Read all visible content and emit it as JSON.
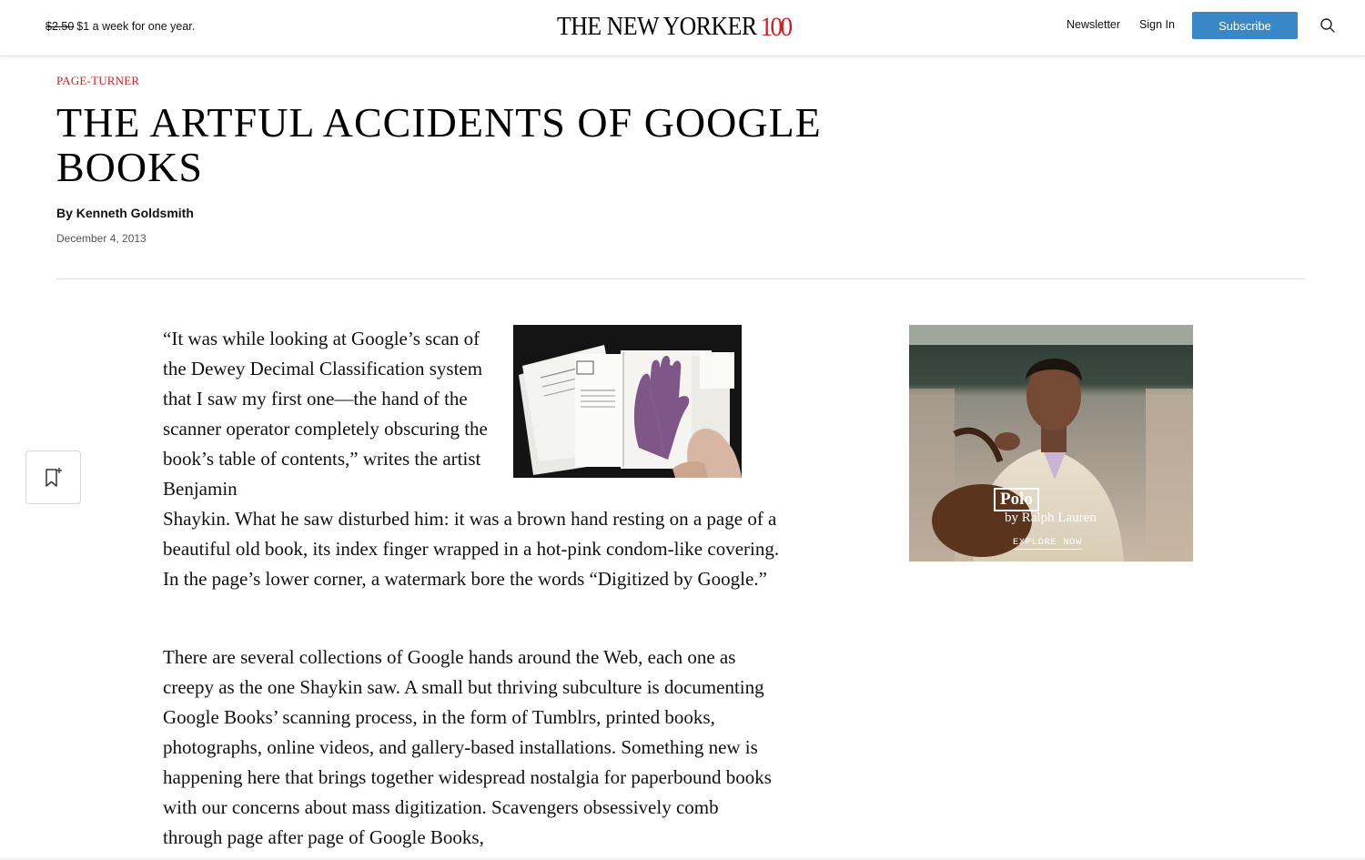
{
  "promo": {
    "old_price": "$2.50",
    "text": "$1 a week for one year."
  },
  "brand": {
    "name": "THE NEW YORKER",
    "anniversary": "100",
    "accent_color": "#d31f27"
  },
  "nav": {
    "newsletter": "Newsletter",
    "sign_in": "Sign In",
    "subscribe": "Subscribe",
    "subscribe_color": "#3a87c8",
    "search_icon": "search-icon"
  },
  "article": {
    "rubric": "PAGE-TURNER",
    "title": "THE ARTFUL ACCIDENTS OF GOOGLE BOOKS",
    "byline": "By Kenneth Goldsmith",
    "date": "December 4, 2013",
    "paragraph1_part1": "“It was while looking at Google’s scan of the Dewey Decimal Classification system that I saw my first one—the hand of the scanner operator completely obscuring the book’s table of contents,” writes the artist Benjamin",
    "paragraph1_part2": "Shaykin. What he saw disturbed him: it was a brown hand resting on a page of a beautiful old book, its index finger wrapped in a hot-pink condom-like covering. In the page’s lower corner, a watermark bore the words “Digitized by Google.”",
    "paragraph2": "There are several collections of Google hands around the Web, each one as creepy as the one Shaykin saw. A small but thriving subculture is documenting Google Books’ scanning process, in the form of Tumblrs, printed books, photographs, online videos, and gallery-based installations. Something new is happening here that brings together widespread nostalgia for paperbound books with our concerns about mass digitization. Scavengers obsessively comb through page after page of Google Books,"
  },
  "ad": {
    "brand": "Polo",
    "sub": "by Ralph Lauren",
    "cta": "EXPLORE NOW"
  },
  "bookmark_icon": "bookmark-add-icon"
}
